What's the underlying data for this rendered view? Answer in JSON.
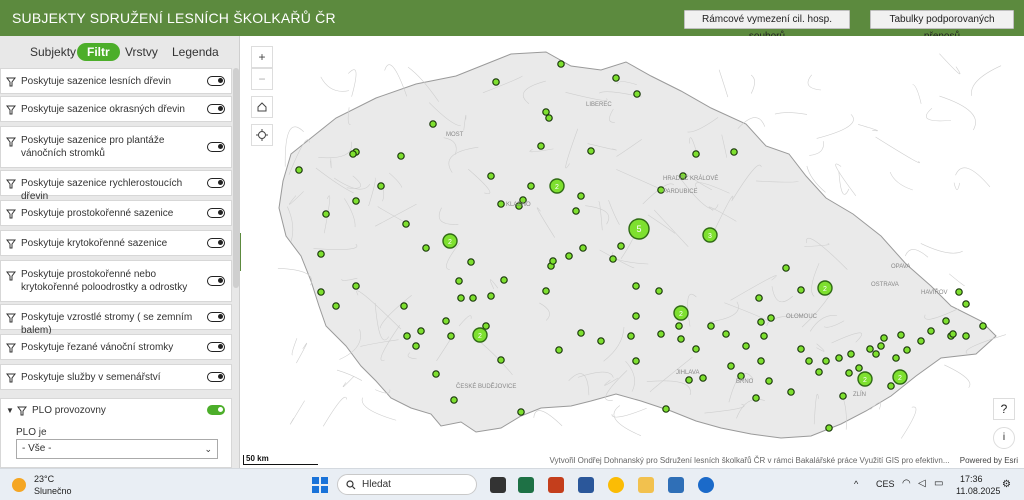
{
  "header": {
    "title": "SUBJEKTY SDRUŽENÍ LESNÍCH ŠKOLKAŘŮ ČR",
    "btn1": "Rámcové vymezení cil. hosp. souborů",
    "btn2": "Tabulky podporovaných přenosů"
  },
  "tabs": [
    "Subjekty",
    "Filtr",
    "Vrstvy",
    "Legenda"
  ],
  "filters": [
    {
      "label": "Poskytuje sazenice lesních dřevin"
    },
    {
      "label": "Poskytuje sazenice okrasných dřevin"
    },
    {
      "label": "Poskytuje sazenice pro plantáže vánočních stromků"
    },
    {
      "label": "Poskytuje sazenice rychlerostoucích dřevin"
    },
    {
      "label": "Poskytuje prostokořenné sazenice"
    },
    {
      "label": "Poskytuje krytokořenné sazenice"
    },
    {
      "label": "Poskytuje prostokořenné nebo krytokořenné poloodrostky a odrostky"
    },
    {
      "label": "Poskytuje vzrostlé stromy ( se zemním balem)"
    },
    {
      "label": "Poskytuje řezané vánoční stromky"
    },
    {
      "label": "Poskytuje služby v semenářství"
    }
  ],
  "plo": {
    "label": "PLO provozovny",
    "sublabel": "PLO je",
    "select_value": "- Vše -"
  },
  "map": {
    "scale": "50 km",
    "attribution": "Vytvořil Ondřej Dohnanský pro Sdružení lesních školkařů ČR v rámci Bakalářské práce Využití GIS pro efektivn...",
    "powered": "Powered by Esri",
    "cities": [
      "LIBEREC",
      "MOST",
      "HRADEC KRÁLOVÉ",
      "PARDUBICE",
      "OSTRAVA",
      "OLOMOUC",
      "BRNO",
      "ZLÍN",
      "JIHLAVA",
      "ČESKÉ BUDĚJOVICE",
      "KLADNO",
      "OPAVA",
      "HAVÍŘOV"
    ],
    "cluster_labels": [
      "2",
      "2",
      "5",
      "3",
      "2",
      "2",
      "2",
      "2",
      "2"
    ]
  },
  "map_controls": {
    "zoom_in": "+",
    "zoom_out": "−",
    "help": "?",
    "info": "i"
  },
  "taskbar": {
    "weather_temp": "23°C",
    "weather_desc": "Slunečno",
    "search_placeholder": "Hledat",
    "lang": "CES",
    "time": "17:36",
    "date": "11.08.2025"
  }
}
